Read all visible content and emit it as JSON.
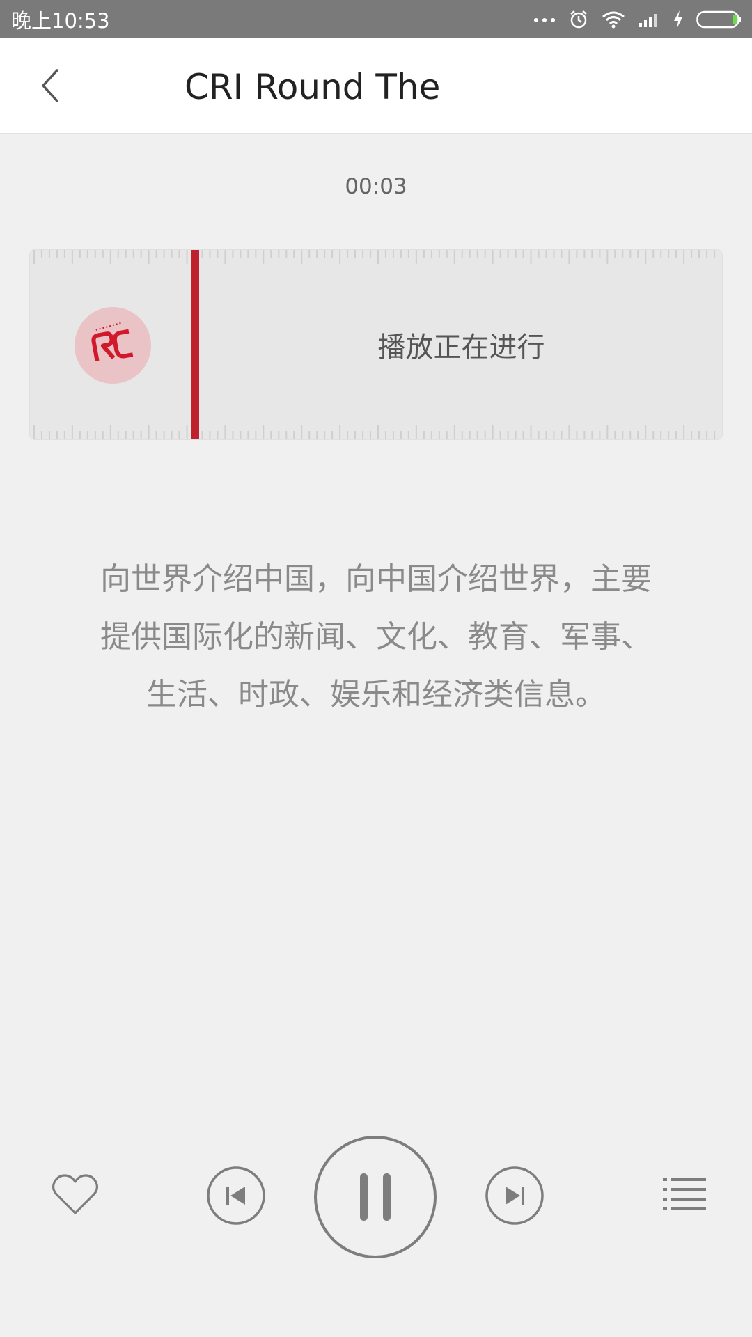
{
  "status_bar": {
    "time": "晚上10:53",
    "icons": [
      "more-icon",
      "alarm-icon",
      "wifi-icon",
      "signal-icon",
      "charging-icon",
      "battery-icon"
    ]
  },
  "header": {
    "title": "CRI Round The",
    "back_icon": "chevron-left-icon"
  },
  "player": {
    "elapsed": "00:03",
    "status_label": "播放正在进行",
    "station_logo_icon": "cri-logo",
    "description_lines": [
      "向世界介绍中国，向中国介绍世界，主要",
      "提供国际化的新闻、文化、教育、军事、",
      "生活、时政、娱乐和经济类信息。"
    ]
  },
  "controls": {
    "favorite_icon": "heart-icon",
    "previous_icon": "skip-previous-icon",
    "pause_icon": "pause-icon",
    "next_icon": "skip-next-icon",
    "playlist_icon": "playlist-icon"
  },
  "colors": {
    "accent": "#c01f2e",
    "status_bar": "#7a7a7a",
    "background": "#f0f0f0",
    "timeline": "#e7e7e7",
    "control_stroke": "#7d7d7d"
  }
}
